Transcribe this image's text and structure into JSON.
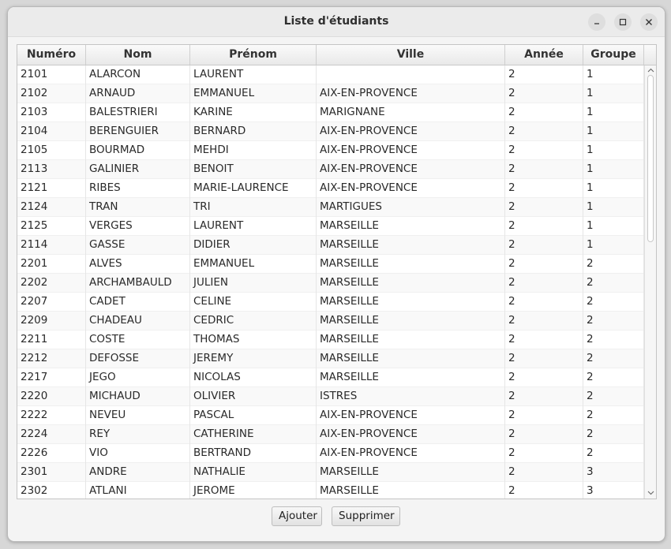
{
  "window": {
    "title": "Liste d'étudiants"
  },
  "table": {
    "columns": [
      "Numéro",
      "Nom",
      "Prénom",
      "Ville",
      "Année",
      "Groupe"
    ],
    "rows": [
      [
        "2101",
        "ALARCON",
        "LAURENT",
        "",
        "2",
        "1"
      ],
      [
        "2102",
        "ARNAUD",
        "EMMANUEL",
        "AIX-EN-PROVENCE",
        "2",
        "1"
      ],
      [
        "2103",
        "BALESTRIERI",
        "KARINE",
        "MARIGNANE",
        "2",
        "1"
      ],
      [
        "2104",
        "BERENGUIER",
        "BERNARD",
        "AIX-EN-PROVENCE",
        "2",
        "1"
      ],
      [
        "2105",
        "BOURMAD",
        "MEHDI",
        "AIX-EN-PROVENCE",
        "2",
        "1"
      ],
      [
        "2113",
        "GALINIER",
        "BENOIT",
        "AIX-EN-PROVENCE",
        "2",
        "1"
      ],
      [
        "2121",
        "RIBES",
        "MARIE-LAURENCE",
        "AIX-EN-PROVENCE",
        "2",
        "1"
      ],
      [
        "2124",
        "TRAN",
        "TRI",
        "MARTIGUES",
        "2",
        "1"
      ],
      [
        "2125",
        "VERGES",
        "LAURENT",
        "MARSEILLE",
        "2",
        "1"
      ],
      [
        "2114",
        "GASSE",
        "DIDIER",
        "MARSEILLE",
        "2",
        "1"
      ],
      [
        "2201",
        "ALVES",
        "EMMANUEL",
        "MARSEILLE",
        "2",
        "2"
      ],
      [
        "2202",
        "ARCHAMBAULD",
        "JULIEN",
        "MARSEILLE",
        "2",
        "2"
      ],
      [
        "2207",
        "CADET",
        "CELINE",
        "MARSEILLE",
        "2",
        "2"
      ],
      [
        "2209",
        "CHADEAU",
        "CEDRIC",
        "MARSEILLE",
        "2",
        "2"
      ],
      [
        "2211",
        "COSTE",
        "THOMAS",
        "MARSEILLE",
        "2",
        "2"
      ],
      [
        "2212",
        "DEFOSSE",
        "JEREMY",
        "MARSEILLE",
        "2",
        "2"
      ],
      [
        "2217",
        "JEGO",
        "NICOLAS",
        "MARSEILLE",
        "2",
        "2"
      ],
      [
        "2220",
        "MICHAUD",
        "OLIVIER",
        "ISTRES",
        "2",
        "2"
      ],
      [
        "2222",
        "NEVEU",
        "PASCAL",
        "AIX-EN-PROVENCE",
        "2",
        "2"
      ],
      [
        "2224",
        "REY",
        "CATHERINE",
        "AIX-EN-PROVENCE",
        "2",
        "2"
      ],
      [
        "2226",
        "VIO",
        "BERTRAND",
        "AIX-EN-PROVENCE",
        "2",
        "2"
      ],
      [
        "2301",
        "ANDRE",
        "NATHALIE",
        "MARSEILLE",
        "2",
        "3"
      ],
      [
        "2302",
        "ATLANI",
        "JEROME",
        "MARSEILLE",
        "2",
        "3"
      ]
    ]
  },
  "buttons": {
    "add": "Ajouter",
    "delete": "Supprimer"
  },
  "icons": {
    "minimize": "minimize-icon",
    "maximize": "maximize-icon",
    "close": "close-icon"
  }
}
